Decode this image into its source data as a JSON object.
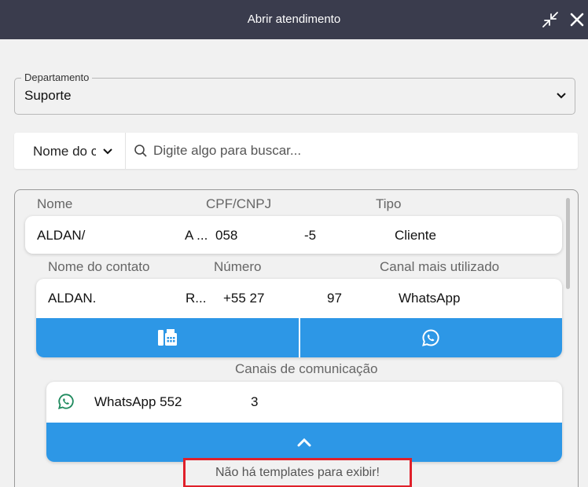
{
  "window": {
    "title": "Abrir atendimento"
  },
  "department": {
    "legend": "Departamento",
    "value": "Suporte"
  },
  "search": {
    "field": "Nome do c",
    "placeholder": "Digite algo para buscar..."
  },
  "client_table": {
    "headers": [
      "Nome",
      "CPF/CNPJ",
      "Tipo"
    ],
    "row": {
      "name": "ALDAN/",
      "name_cont": "A ...",
      "doc": "058",
      "doc_cont": "-5",
      "type": "Cliente"
    }
  },
  "contact_table": {
    "headers": [
      "Nome do contato",
      "Número",
      "Canal mais utilizado"
    ],
    "row": {
      "name": "ALDAN.",
      "name_cont": "R...",
      "number": "+55 27",
      "number_cont": "97",
      "channel": "WhatsApp"
    }
  },
  "channels": {
    "title": "Canais de comunicação",
    "items": [
      {
        "label": "WhatsApp 552",
        "label_cont": "3"
      }
    ]
  },
  "templates": {
    "empty_message": "Não há templates para exibir!"
  },
  "icons": {
    "minimize": "minimize-arrows-icon",
    "close": "close-icon",
    "phone": "phone-fax-icon",
    "whatsapp": "whatsapp-icon",
    "search": "search-icon",
    "chevron_up": "chevron-up-icon",
    "chevron_down": "chevron-down-icon"
  },
  "colors": {
    "titlebar": "#3a3c4d",
    "accent": "#2d97e6",
    "whatsapp": "#1f8a5e",
    "highlight": "#e0202a"
  }
}
